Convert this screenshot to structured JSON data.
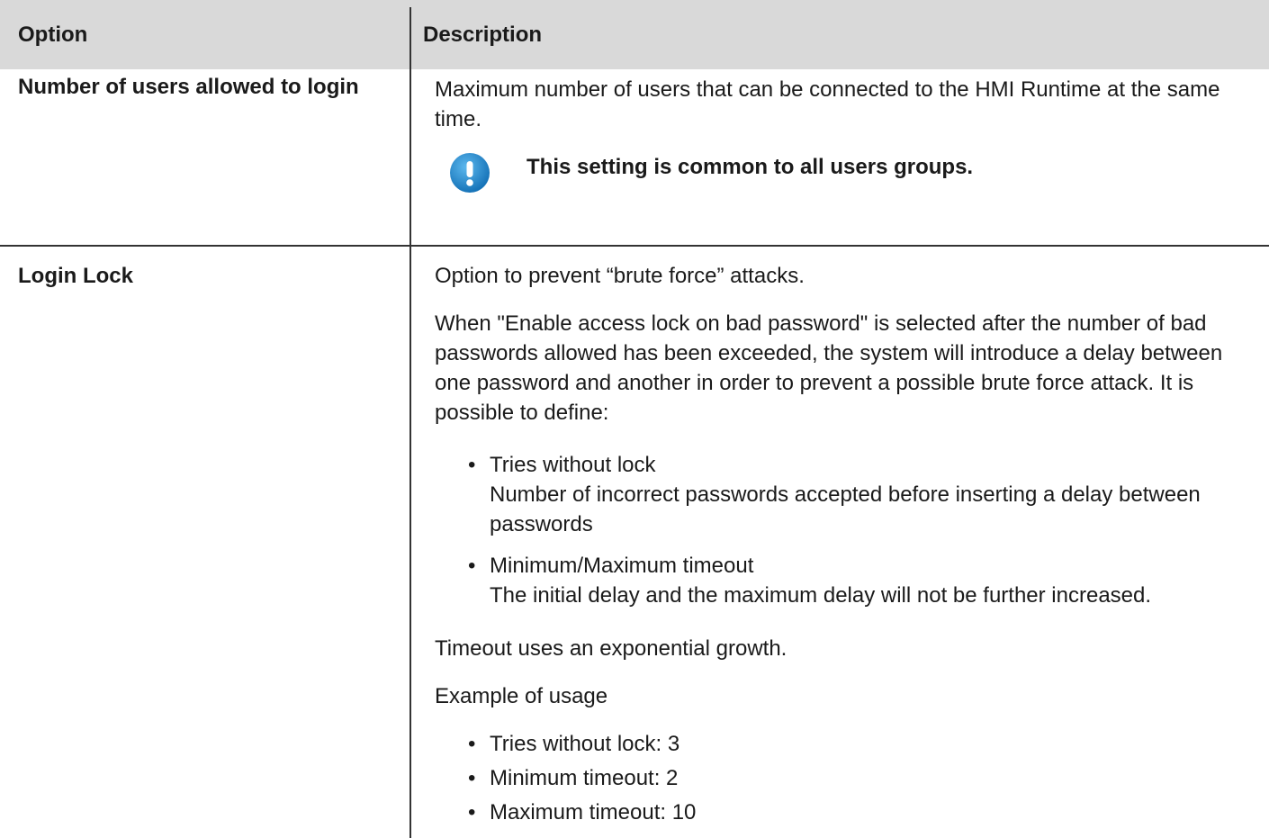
{
  "table": {
    "headers": {
      "option": "Option",
      "description": "Description"
    },
    "row1": {
      "option": "Number of users allowed to login",
      "description": "Maximum number of users that can be connected to the HMI Runtime at the same time.",
      "note_icon": "exclamation-icon",
      "note": "This setting is common to all users groups."
    },
    "row2": {
      "option": "Login Lock",
      "intro": "Option to prevent “brute force” attacks.",
      "paragraph": "When \"Enable access lock on bad password\" is selected after the number of bad passwords allowed has been exceeded, the system will introduce a delay between one password and another in order to prevent a possible brute force attack. It is possible to define:",
      "define_items": [
        {
          "title": "Tries without lock",
          "detail": "Number of incorrect passwords accepted before inserting a delay between passwords"
        },
        {
          "title": "Minimum/Maximum timeout",
          "detail": "The initial delay and the maximum delay will not be further increased."
        }
      ],
      "growth": "Timeout uses an exponential growth.",
      "example_label": "Example of usage",
      "example_items": [
        "Tries without lock: 3",
        "Minimum timeout: 2",
        "Maximum timeout: 10"
      ]
    }
  },
  "colors": {
    "header_bg": "#d9d9d9",
    "icon_blue": "#1e88c8",
    "rule": "#333333"
  }
}
